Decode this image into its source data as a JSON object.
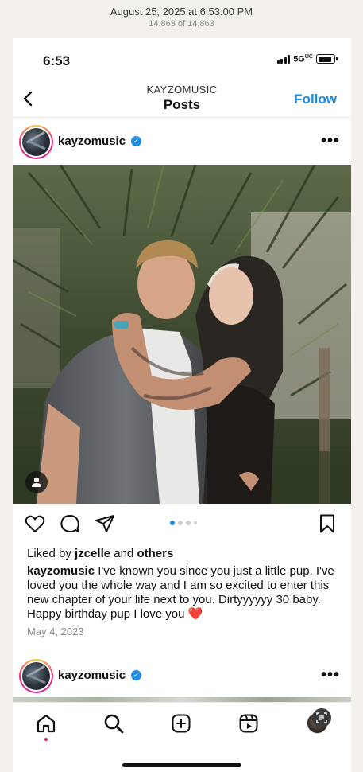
{
  "photos_viewer": {
    "date": "August 25, 2025 at 6:53:00 PM",
    "count": "14,863 of 14,863"
  },
  "status_bar": {
    "time": "6:53",
    "network": "5G",
    "network_suffix": "UC"
  },
  "header": {
    "account": "KAYZOMUSIC",
    "title": "Posts",
    "follow_label": "Follow"
  },
  "post": {
    "username": "kayzomusic",
    "verified_mark": "✓",
    "more_label": "•••",
    "carousel": {
      "count": 4,
      "active": 1
    },
    "likes": {
      "prefix": "Liked by",
      "user": "jzcelle",
      "connector": "and",
      "others": "others"
    },
    "caption": {
      "username": "kayzomusic",
      "text": "I've known you since you just a little pup. I've loved you the whole way and I am so excited to enter this new chapter of your life next to you. Dirtyyyyyy 30 baby. Happy birthday pup I love you",
      "emoji": "❤️"
    },
    "date": "May 4, 2023"
  },
  "next_post": {
    "username": "kayzomusic",
    "verified_mark": "✓",
    "more_label": "•••"
  },
  "tab_bar": {
    "icons": [
      "home-icon",
      "search-icon",
      "create-icon",
      "reels-icon",
      "profile-avatar"
    ],
    "active": "home-icon"
  },
  "colors": {
    "accent": "#1b8de6",
    "verified": "#1b8de6",
    "notification_dot": "#e0245e"
  }
}
